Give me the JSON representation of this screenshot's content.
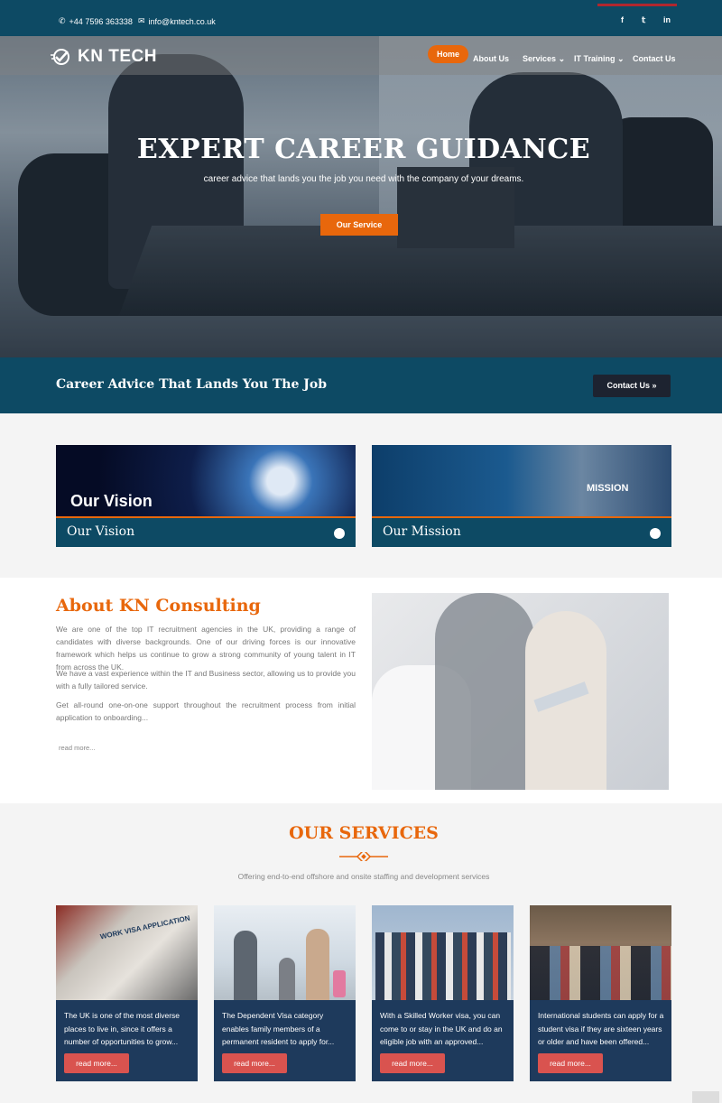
{
  "topbar": {
    "phone": "+44 7596 363338",
    "email": "info@kntech.co.uk",
    "social": [
      "f",
      "𝕥",
      "in"
    ]
  },
  "logo": {
    "text": "KN TECH"
  },
  "nav": {
    "items": [
      "Home",
      "About Us",
      "Services",
      "IT Training",
      "Contact Us"
    ],
    "active": "Home"
  },
  "hero": {
    "title": "EXPERT CAREER GUIDANCE",
    "subtitle": "career advice that lands you the job you need with the company of your dreams.",
    "button": "Our Service"
  },
  "cta": {
    "title": "Career Advice That Lands You The Job",
    "button": "Contact Us"
  },
  "cards": [
    {
      "label": "Our Vision",
      "overlay": "Our Vision"
    },
    {
      "label": "Our Mission",
      "overlay": "MISSION"
    }
  ],
  "about": {
    "title": "About KN Consulting",
    "p1": "We are one of the top IT recruitment agencies in the UK, providing a range of candidates with diverse backgrounds. One of our driving forces is our innovative framework which helps us continue to grow a strong community of young talent in IT from across the UK.",
    "p2": "We have a vast experience within the IT and Business sector, allowing us to provide you with a fully tailored service.",
    "p3": "Get all-round one-on-one support throughout the recruitment process from initial application to onboarding...",
    "readmore": "read more..."
  },
  "services": {
    "title": "OUR SERVICES",
    "subtitle": "Offering end-to-end offshore and onsite staffing and development services",
    "items": [
      {
        "text": "The UK is one of the most diverse places to live in, since it offers a number of opportunities to grow...",
        "button": "read more..."
      },
      {
        "text": "The Dependent Visa category enables family members of a permanent resident to apply for...",
        "button": "read more..."
      },
      {
        "text": "With a Skilled Worker visa, you can come to or stay in the UK and do an eligible job with an approved...",
        "button": "read more..."
      },
      {
        "text": "International students can apply for a student visa if they are sixteen years or older and have been offered...",
        "button": "read more..."
      }
    ],
    "image_labels": [
      "WORK VISA APPLICATION"
    ]
  },
  "colors": {
    "brand": "#0d4a64",
    "accent": "#e8670c",
    "dark": "#1e3a5c",
    "button_red": "#d9534f"
  }
}
